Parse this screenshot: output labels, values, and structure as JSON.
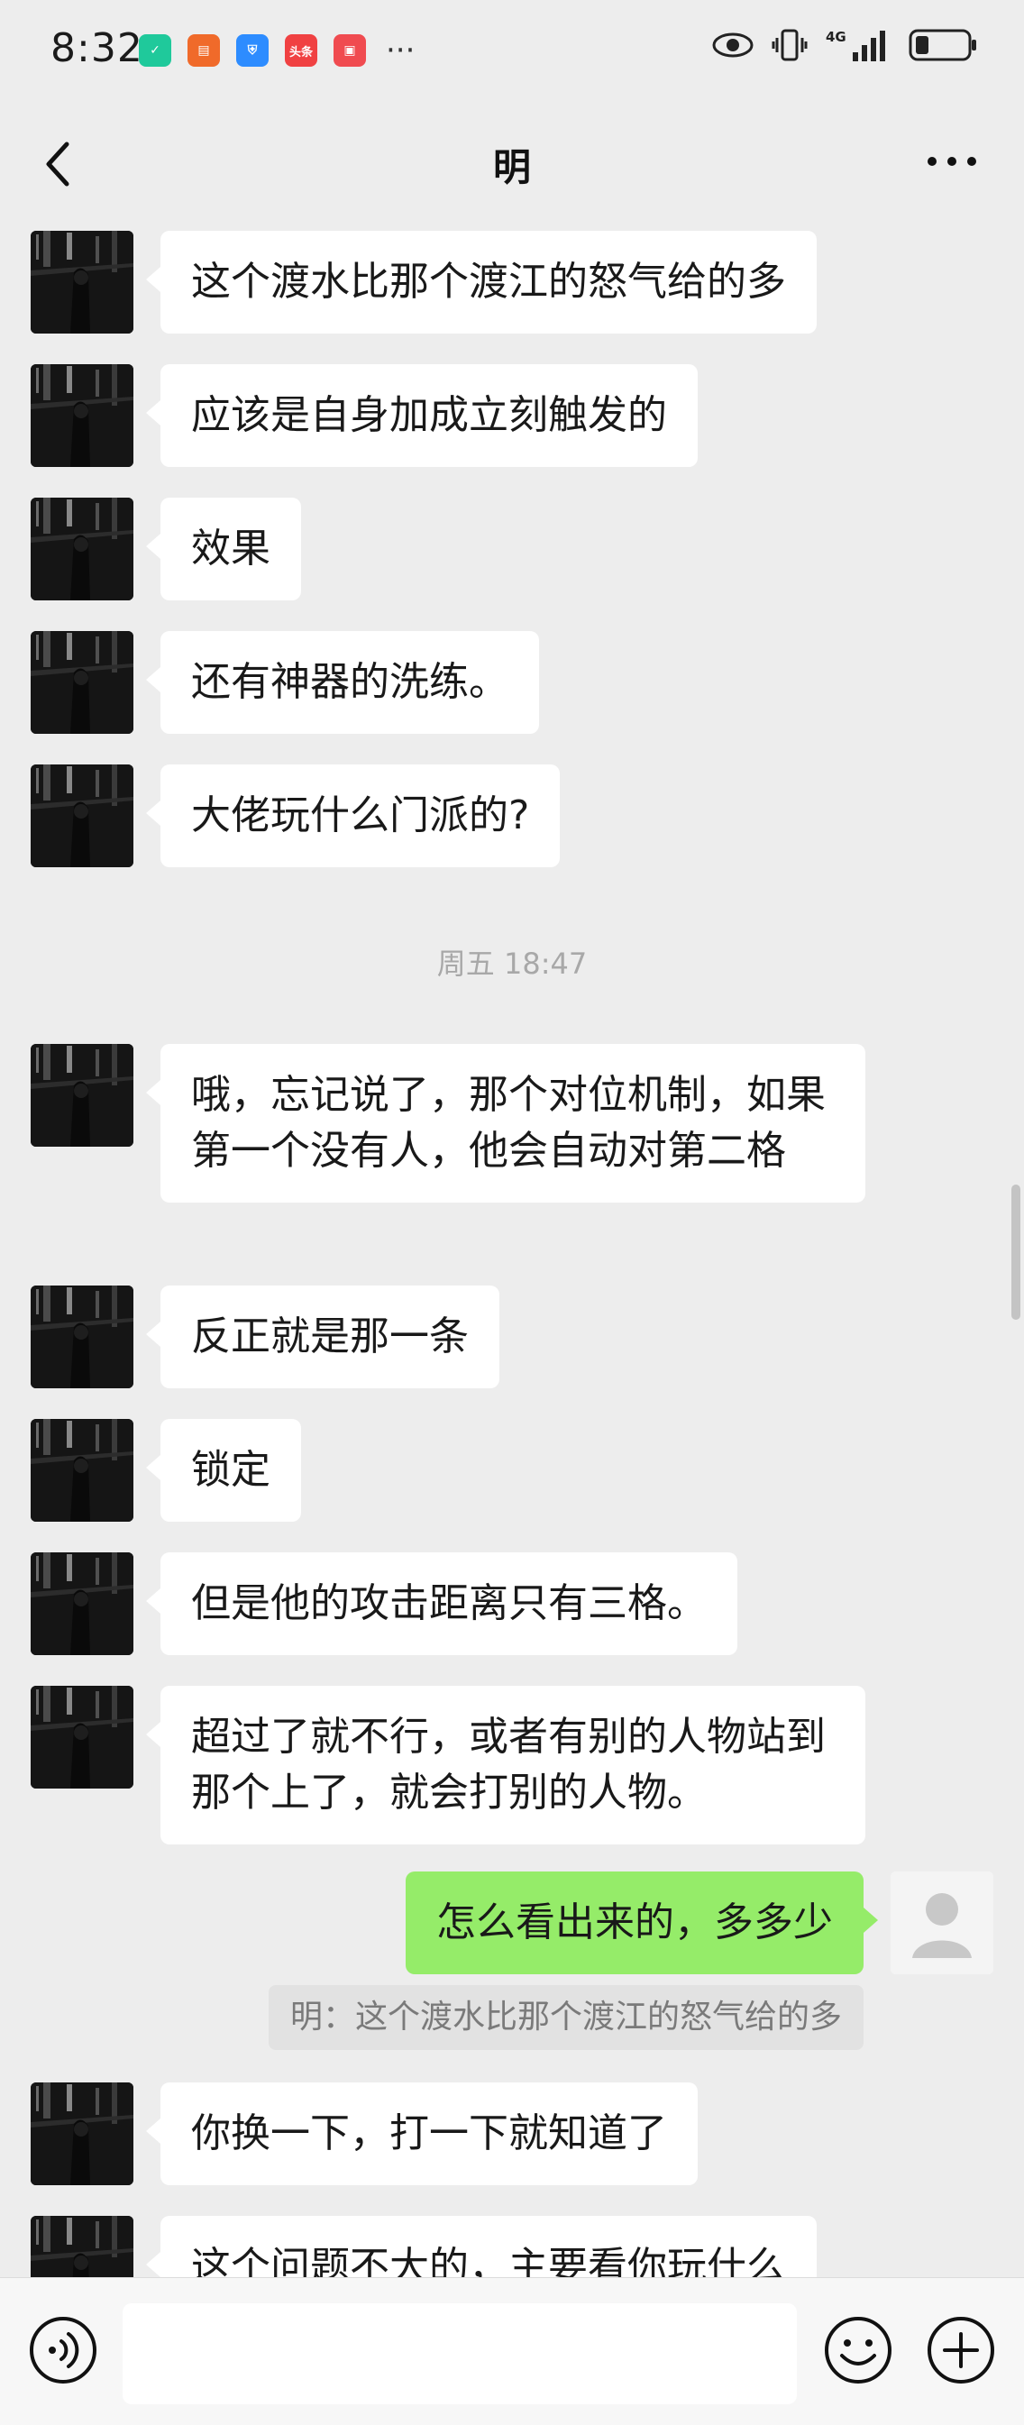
{
  "status_bar": {
    "time": "8:32",
    "app_icons": [
      {
        "icon": "shield-check-icon",
        "color": "#1fc99b",
        "glyph": "✓"
      },
      {
        "icon": "stack-app-icon",
        "color": "#f06a2a",
        "glyph": "▤"
      },
      {
        "icon": "shield-blue-icon",
        "color": "#2d8cff",
        "glyph": "⛨"
      },
      {
        "icon": "toutiao-icon",
        "color": "#f04142",
        "glyph": "头条"
      },
      {
        "icon": "red-app-icon",
        "color": "#f04b50",
        "glyph": "▣"
      }
    ],
    "more": "···",
    "network_label": "4G"
  },
  "header": {
    "title": "明"
  },
  "messages": [
    {
      "type": "in",
      "text": "这个渡水比那个渡江的怒气给的多"
    },
    {
      "type": "in",
      "text": "应该是自身加成立刻触发的"
    },
    {
      "type": "in",
      "text": "效果"
    },
    {
      "type": "in",
      "text": "还有神器的洗练。"
    },
    {
      "type": "in",
      "text": "大佬玩什么门派的?"
    },
    {
      "type": "time",
      "text": "周五 18:47"
    },
    {
      "type": "in",
      "text": "哦，忘记说了，那个对位机制，如果第一个没有人，他会自动对第二格"
    },
    {
      "type": "in",
      "text": "反正就是那一条"
    },
    {
      "type": "in",
      "text": "锁定"
    },
    {
      "type": "in",
      "text": "但是他的攻击距离只有三格。"
    },
    {
      "type": "in",
      "text": "超过了就不行，或者有别的人物站到那个上了，就会打别的人物。"
    },
    {
      "type": "out",
      "text": "怎么看出来的，多多少"
    },
    {
      "type": "quote",
      "text": "明：这个渡水比那个渡江的怒气给的多"
    },
    {
      "type": "in",
      "text": "你换一下，打一下就知道了"
    },
    {
      "type": "in",
      "text": "这个问题不大的，主要看你玩什么"
    }
  ],
  "input_bar": {
    "voice_icon": "voice-icon",
    "emoji_icon": "emoji-icon",
    "plus_icon": "plus-icon",
    "placeholder": ""
  },
  "colors": {
    "background": "#ededed",
    "incoming_bubble": "#ffffff",
    "outgoing_bubble": "#95ec69",
    "timestamp": "#a8a8a8"
  }
}
